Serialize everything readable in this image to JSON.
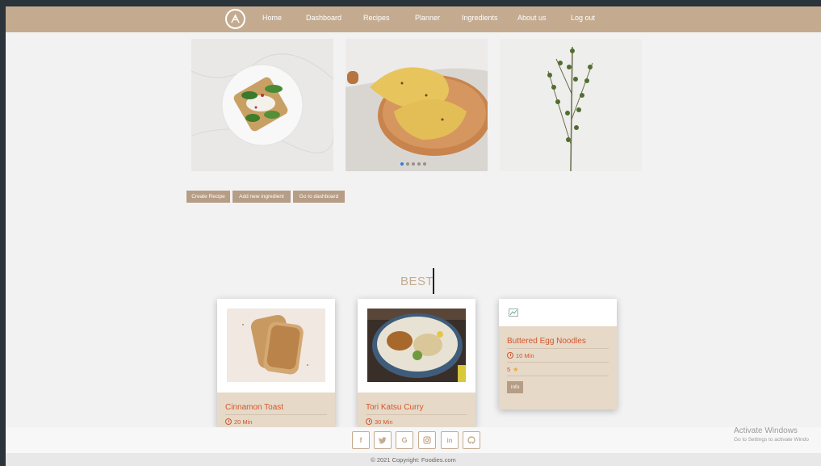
{
  "nav": {
    "items": [
      "Home",
      "Dashboard",
      "Recipes",
      "Planner",
      "Ingredients",
      "About us",
      "Log out"
    ]
  },
  "carousel": {
    "slide_count": 5,
    "active_slide": 1
  },
  "actions": {
    "create_recipe": "Create Recipe",
    "add_ingredient": "Add new ingredient",
    "go_dashboard": "Go to dashboard"
  },
  "best": {
    "title": "BEST",
    "cards": [
      {
        "title": "Cinnamon Toast",
        "time": "20 Min"
      },
      {
        "title": "Tori Katsu Curry",
        "time": "30 Min"
      },
      {
        "title": "Buttered Egg Noodles",
        "time": "10 Min",
        "rating": "5",
        "info": "info"
      }
    ]
  },
  "footer": {
    "social_icons": [
      "facebook-icon",
      "twitter-icon",
      "google-icon",
      "instagram-icon",
      "linkedin-icon",
      "github-icon"
    ],
    "copyright": "© 2021 Copyright: Foodies.com"
  },
  "os_overlay": {
    "activate_title": "Activate Windows",
    "activate_sub": "Go to Settings to activate Windo"
  },
  "colors": {
    "navbar": "#c4ab90",
    "accent_text": "#d2562b",
    "card_body": "#e6d9c8",
    "button": "#b69d86"
  }
}
